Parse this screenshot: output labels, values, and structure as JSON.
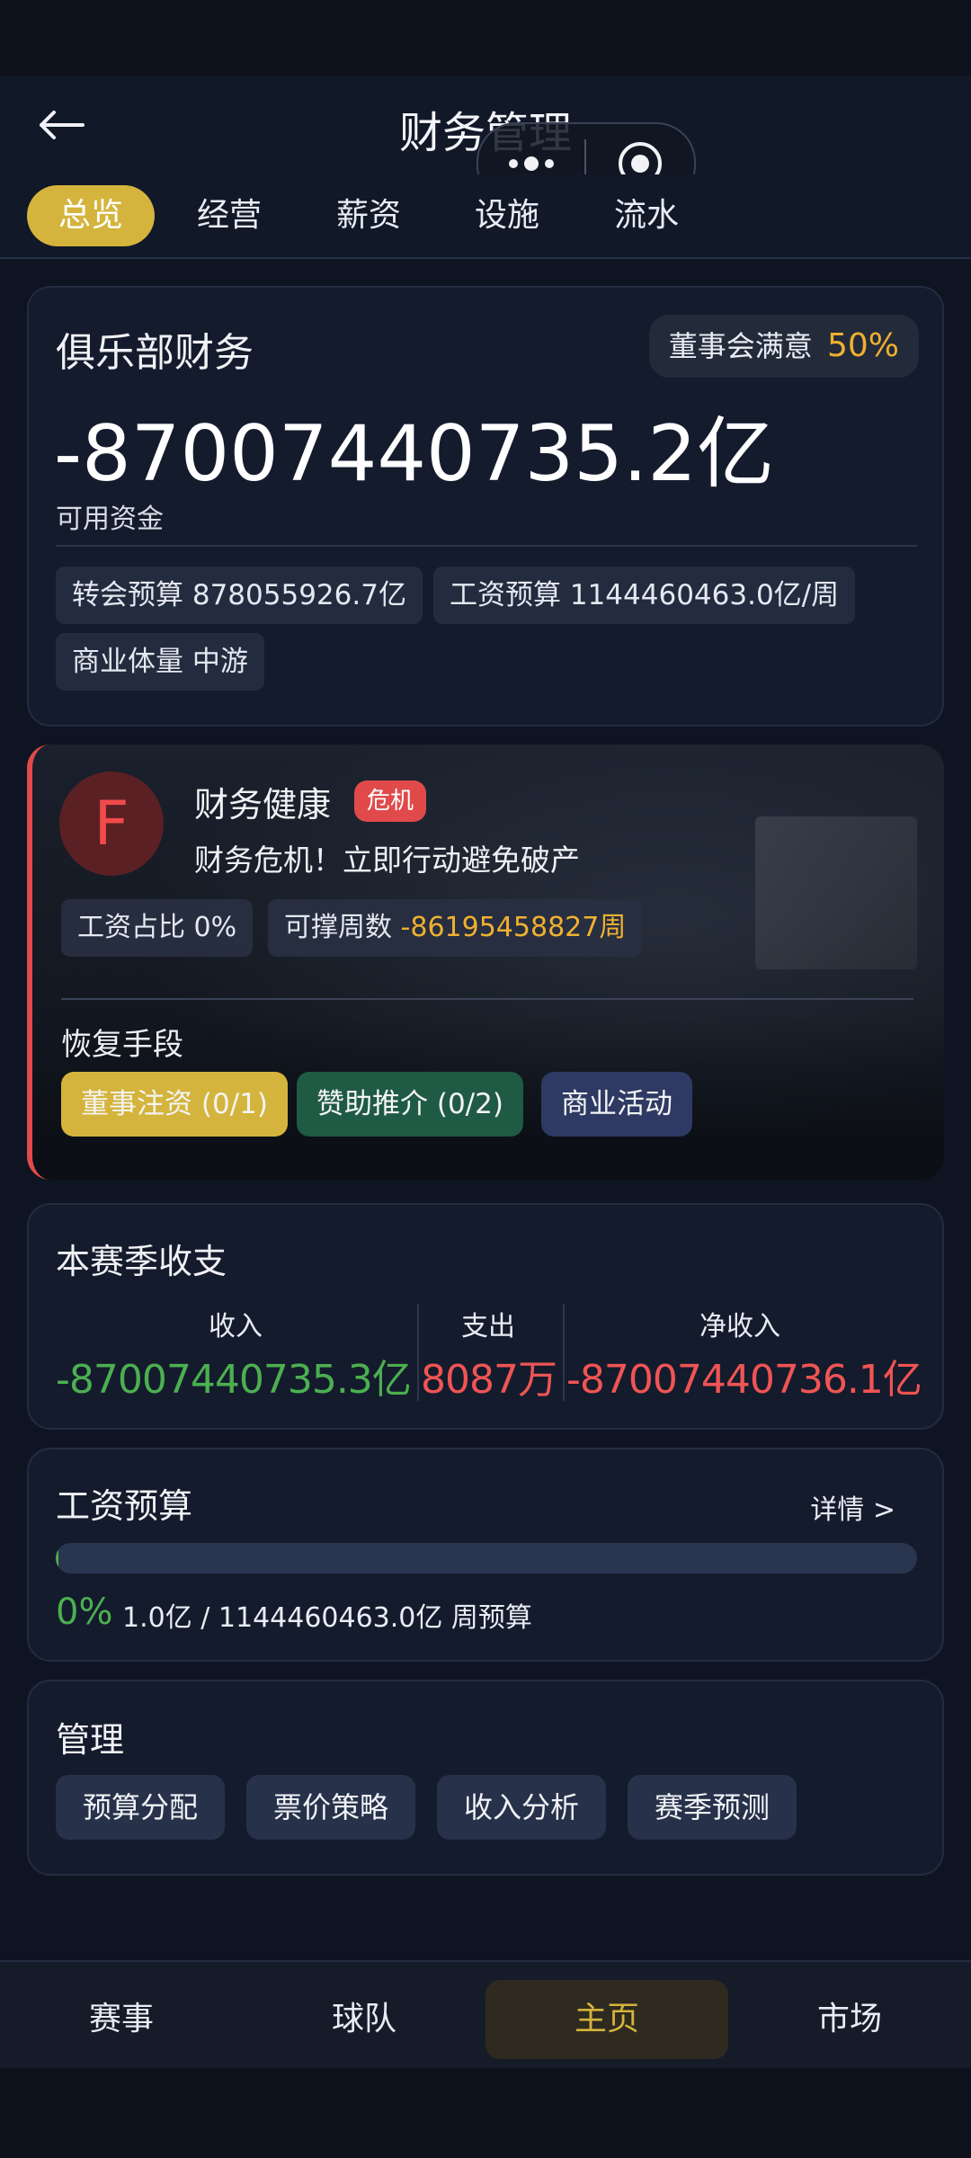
{
  "header": {
    "title": "财务管理"
  },
  "tabs": [
    {
      "label": "总览",
      "active": true
    },
    {
      "label": "经营"
    },
    {
      "label": "薪资"
    },
    {
      "label": "设施"
    },
    {
      "label": "流水"
    }
  ],
  "club_finance": {
    "title": "俱乐部财务",
    "board_label": "董事会满意",
    "board_value": "50%",
    "funds": "-87007440735.2亿",
    "funds_label": "可用资金",
    "transfer_budget": "转会预算 878055926.7亿",
    "wage_budget": "工资预算 1144460463.0亿/周",
    "commercial_label": "商业体量",
    "commercial_value": "中游"
  },
  "health": {
    "grade": "F",
    "title": "财务健康",
    "badge": "危机",
    "message": "财务危机！立即行动避免破产",
    "wage_ratio": "工资占比 0%",
    "weeks_label": "可撑周数",
    "weeks_value": "-86195458827周",
    "recovery_title": "恢复手段",
    "actions": [
      {
        "label": "董事注资 (0/1)",
        "color": "#d4b43c"
      },
      {
        "label": "赞助推介 (0/2)",
        "color": "#1f5a45"
      },
      {
        "label": "商业活动",
        "color": "#2e3a63"
      }
    ]
  },
  "season": {
    "title": "本赛季收支",
    "income_label": "收入",
    "income_value": "-87007440735.3亿",
    "expense_label": "支出",
    "expense_value": "8087万",
    "net_label": "净收入",
    "net_value": "-87007440736.1亿"
  },
  "wage": {
    "title": "工资预算",
    "detail": "详情 >",
    "percent": "0%",
    "summary": "1.0亿 / 1144460463.0亿 周预算",
    "fill": 0.0
  },
  "management": {
    "title": "管理",
    "buttons": [
      "预算分配",
      "票价策略",
      "收入分析",
      "赛季预测"
    ]
  },
  "nav": [
    {
      "label": "赛事"
    },
    {
      "label": "球队"
    },
    {
      "label": "主页",
      "active": true
    },
    {
      "label": "市场"
    }
  ],
  "colors": {
    "accent": "#d4b43c",
    "green": "#4caf50",
    "red": "#f05454",
    "orange": "#f0b030"
  }
}
